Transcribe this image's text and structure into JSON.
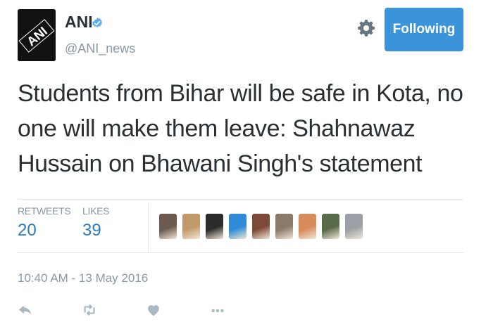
{
  "account": {
    "name": "ANI",
    "handle": "@ANI_news",
    "avatar_text": "ANI",
    "verified": true
  },
  "follow_button": {
    "label": "Following"
  },
  "tweet": {
    "text": "Students from Bihar will be safe in Kota, no one will make them leave: Shahnawaz Hussain on Bhawani Singh's statement",
    "timestamp": "10:40 AM - 13 May 2016"
  },
  "stats": {
    "retweets": {
      "label": "RETWEETS",
      "value": "20"
    },
    "likes": {
      "label": "LIKES",
      "value": "39"
    }
  },
  "likers": [
    {
      "name": "liker-avatar-1",
      "color": "#6b5a4e"
    },
    {
      "name": "liker-avatar-2",
      "color": "#c29a6a"
    },
    {
      "name": "liker-avatar-3",
      "color": "#2c2c2c"
    },
    {
      "name": "liker-avatar-4",
      "color": "#2f8bd6"
    },
    {
      "name": "liker-avatar-5",
      "color": "#7d4a3a"
    },
    {
      "name": "liker-avatar-6",
      "color": "#8a7a6a"
    },
    {
      "name": "liker-avatar-7",
      "color": "#d88b5a"
    },
    {
      "name": "liker-avatar-8",
      "color": "#5a6b4a"
    },
    {
      "name": "liker-avatar-9",
      "color": "#9aa0a6"
    }
  ],
  "actions": [
    "reply-icon",
    "retweet-icon",
    "like-icon",
    "more-icon"
  ],
  "colors": {
    "accent": "#3b94d9",
    "stat_value": "#2b7bb9",
    "muted": "#8899a6",
    "text": "#292f33"
  }
}
